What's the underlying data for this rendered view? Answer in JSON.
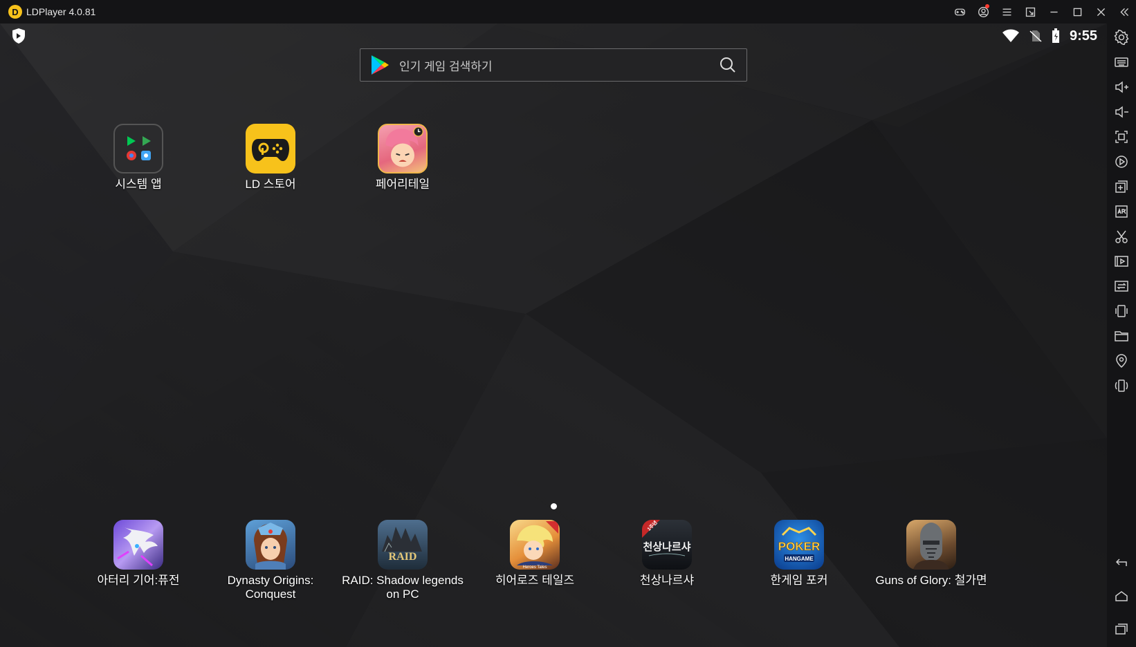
{
  "window": {
    "title": "LDPlayer 4.0.81",
    "logo_letter": "D"
  },
  "titlebar_buttons": [
    "gamepad-icon",
    "account-icon",
    "menu-icon",
    "restore-screen-icon",
    "minimize-icon",
    "maximize-icon",
    "close-icon",
    "collapse-sidebar-icon"
  ],
  "status": {
    "time": "9:55"
  },
  "search": {
    "placeholder": "인기 게임 검색하기"
  },
  "home_apps": [
    {
      "label": "시스템 앱"
    },
    {
      "label": "LD 스토어"
    },
    {
      "label": "페어리테일"
    }
  ],
  "dock_apps": [
    {
      "label": "아터리 기어:퓨전"
    },
    {
      "label": "Dynasty Origins:\nConquest"
    },
    {
      "label": "RAID: Shadow legends\non PC"
    },
    {
      "label": "히어로즈 테일즈"
    },
    {
      "label": "천상나르샤"
    },
    {
      "label": "한게임 포커"
    },
    {
      "label": "Guns of Glory: 철가면"
    }
  ],
  "icon_text": {
    "raid": "RAID",
    "poker": "POKER",
    "hangame": "HANGAME",
    "heroes": "Heroes Tales",
    "cheonsang": "천상나르샤",
    "badge": "1주년"
  },
  "sidebar_tools": [
    "settings-icon",
    "keyboard-icon",
    "volume-up-icon",
    "volume-down-icon",
    "screenshot-icon",
    "record-icon",
    "multi-instance-icon",
    "apk-install-icon",
    "scissors-icon",
    "video-icon",
    "sync-icon",
    "shake-icon",
    "folder-icon",
    "location-icon",
    "rotate-icon"
  ],
  "sidebar_nav": [
    "back-icon",
    "home-icon",
    "recent-apps-icon"
  ],
  "colors": {
    "ld_yellow": "#f7c21b",
    "titlebar": "#141416",
    "background": "#1f1f21"
  }
}
